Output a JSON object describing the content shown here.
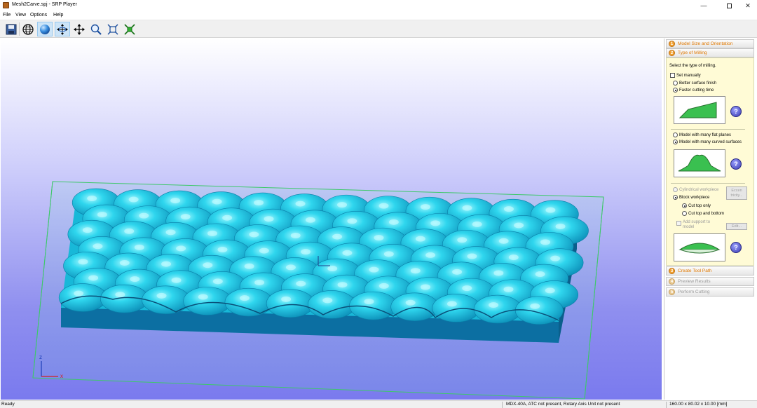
{
  "window": {
    "title": "Mesh2Carve.spj - SRP Player",
    "minimize_glyph": "—",
    "close_glyph": "✕"
  },
  "menu": [
    "File",
    "View",
    "Options",
    "Help"
  ],
  "toolbar": {
    "buttons": [
      {
        "icon": "save-icon"
      },
      {
        "icon": "wireframe-globe-icon"
      },
      {
        "icon": "shaded-sphere-icon",
        "active": true
      },
      {
        "icon": "rotate-icon",
        "active": true
      },
      {
        "icon": "pan-icon"
      },
      {
        "icon": "zoom-icon"
      },
      {
        "icon": "fit-view-icon"
      },
      {
        "icon": "reset-view-icon"
      }
    ]
  },
  "viewport": {
    "axes": {
      "z": "z",
      "x": "x"
    },
    "colors": {
      "model_top": "#1fc0dc",
      "model_side": "#0c6fa2",
      "bounding_box": "#3ec86a"
    }
  },
  "panel": {
    "sections": [
      {
        "num": "1",
        "label": "Model Size and Orientation"
      },
      {
        "num": "2",
        "label": "Type of Milling"
      },
      {
        "num": "3",
        "label": "Create Tool Path"
      },
      {
        "num": "4",
        "label": "Preview Results"
      },
      {
        "num": "5",
        "label": "Perform Cutting"
      }
    ],
    "milling": {
      "prompt": "Select the type of milling.",
      "set_manually": "Set manually",
      "better_finish": "Better surface finish",
      "faster_cutting": "Faster cutting time",
      "flat_planes": "Model with many flat planes",
      "curved_surfaces": "Model with many curved surfaces",
      "cylindrical": "Cylindrical workpiece",
      "eccentricity_line1": "Eccen",
      "eccentricity_line2": "tricity...",
      "block": "Block workpiece",
      "cut_top_only": "Cut top only",
      "cut_top_bottom": "Cut top and bottom",
      "add_support_line1": "Add support to",
      "add_support_line2": "model",
      "edit": "Edit...",
      "help_glyph": "?"
    }
  },
  "status": {
    "left": "Ready",
    "machine": "MDX-40A, ATC not present, Rotary Axis Unit not present",
    "dimensions": "160.00 x 80.02 x 10.00 [mm]"
  }
}
